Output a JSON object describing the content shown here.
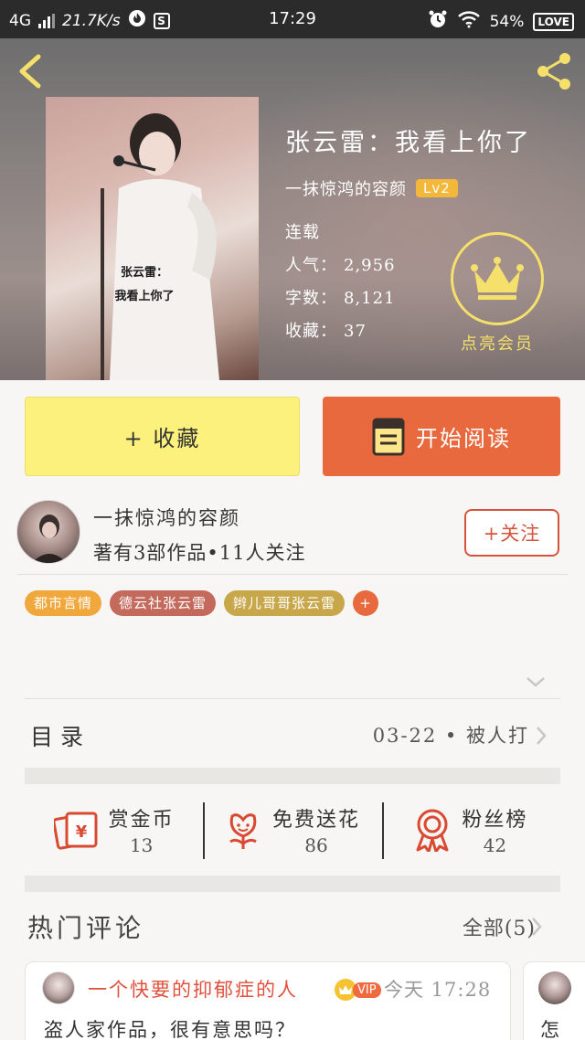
{
  "status_bar": {
    "network": "4G",
    "speed": "21.7K/s",
    "time": "17:29",
    "battery": "54%",
    "love_badge": "LOVE"
  },
  "book": {
    "title": "张云雷：我看上你了",
    "author": "一抹惊鸿的容颜",
    "author_level": "Lv2",
    "status": "连载",
    "stats": [
      {
        "label": "人气：",
        "value": "2,956"
      },
      {
        "label": "字数：",
        "value": "8,121"
      },
      {
        "label": "收藏：",
        "value": "37"
      }
    ],
    "cover_text": [
      "张云雷：",
      "我看上你了"
    ],
    "vip_label": "点亮会员"
  },
  "actions": {
    "collect_label": "+ 收藏",
    "read_label": "开始阅读"
  },
  "author_card": {
    "name": "一抹惊鸿的容颜",
    "works": "著有3部作品•11人关注",
    "follow_label": "+关注"
  },
  "tags": [
    "都市言情",
    "德云社张云雷",
    "辫儿哥哥张云雷",
    "+"
  ],
  "toc": {
    "label": "目录",
    "latest": "03-22 • 被人打"
  },
  "rewards": [
    {
      "label": "赏金币",
      "value": "13",
      "icon": "red-envelope-icon"
    },
    {
      "label": "免费送花",
      "value": "86",
      "icon": "flower-icon"
    },
    {
      "label": "粉丝榜",
      "value": "42",
      "icon": "medal-icon"
    }
  ],
  "hot_comments": {
    "title": "热门评论",
    "all_label": "全部(5)",
    "items": [
      {
        "user": "一个快要的抑郁症的人",
        "badge": "VIP",
        "time": "今天 17:28",
        "body": "盗人家作品，很有意思吗？"
      },
      {
        "user": "",
        "body": "怎"
      }
    ]
  },
  "colors": {
    "accent": "#e8693d",
    "collect_bg": "#fbf17c",
    "vip_gold": "#f5e06b",
    "tag_orange": "#f0a73c",
    "tag_red": "#c46a5c",
    "tag_gold": "#c8a64a",
    "comment_name": "#e0503c"
  }
}
